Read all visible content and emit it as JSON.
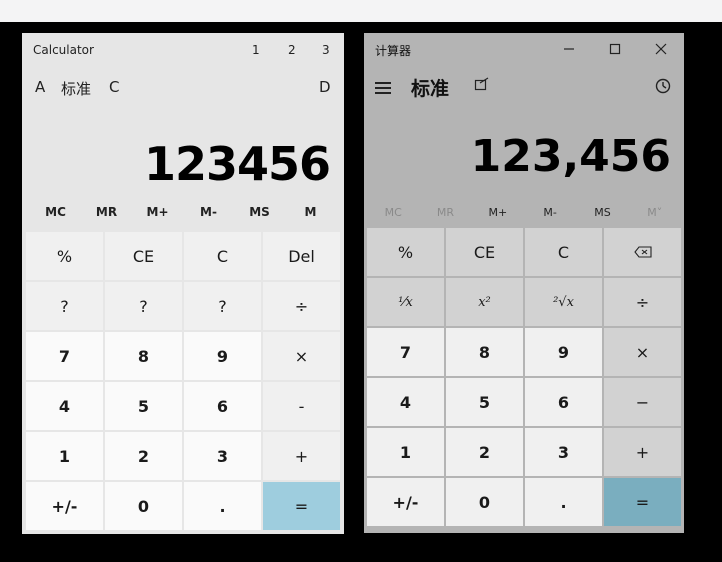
{
  "left": {
    "title": "Calculator",
    "tab_numbers": [
      "1",
      "2",
      "3"
    ],
    "mode_a": "A",
    "mode_label": "标准",
    "mode_c": "C",
    "mode_d": "D",
    "display": "123456",
    "memory": [
      "MC",
      "MR",
      "M+",
      "M-",
      "MS",
      "M"
    ],
    "keys": [
      {
        "label": "%",
        "kind": "op"
      },
      {
        "label": "CE",
        "kind": "op"
      },
      {
        "label": "C",
        "kind": "op"
      },
      {
        "label": "Del",
        "kind": "op"
      },
      {
        "label": "?",
        "kind": "op"
      },
      {
        "label": "?",
        "kind": "op"
      },
      {
        "label": "?",
        "kind": "op"
      },
      {
        "label": "÷",
        "kind": "op"
      },
      {
        "label": "7",
        "kind": "num"
      },
      {
        "label": "8",
        "kind": "num"
      },
      {
        "label": "9",
        "kind": "num"
      },
      {
        "label": "×",
        "kind": "op"
      },
      {
        "label": "4",
        "kind": "num"
      },
      {
        "label": "5",
        "kind": "num"
      },
      {
        "label": "6",
        "kind": "num"
      },
      {
        "label": "-",
        "kind": "op"
      },
      {
        "label": "1",
        "kind": "num"
      },
      {
        "label": "2",
        "kind": "num"
      },
      {
        "label": "3",
        "kind": "num"
      },
      {
        "label": "+",
        "kind": "op"
      },
      {
        "label": "+/-",
        "kind": "num"
      },
      {
        "label": "0",
        "kind": "num"
      },
      {
        "label": ".",
        "kind": "num"
      },
      {
        "label": "=",
        "kind": "eq"
      }
    ]
  },
  "right": {
    "title": "计算器",
    "mode_label": "标准",
    "display": "123,456",
    "memory": [
      "MC",
      "MR",
      "M+",
      "M-",
      "MS",
      "M˅"
    ],
    "keys_row1": [
      "%",
      "CE",
      "C"
    ],
    "keys_row2": [
      "¹⁄x",
      "x²",
      "²√x",
      "÷"
    ],
    "digits": [
      "7",
      "8",
      "9",
      "×",
      "4",
      "5",
      "6",
      "−",
      "1",
      "2",
      "3",
      "+",
      "+/-",
      "0",
      ".",
      "="
    ]
  }
}
